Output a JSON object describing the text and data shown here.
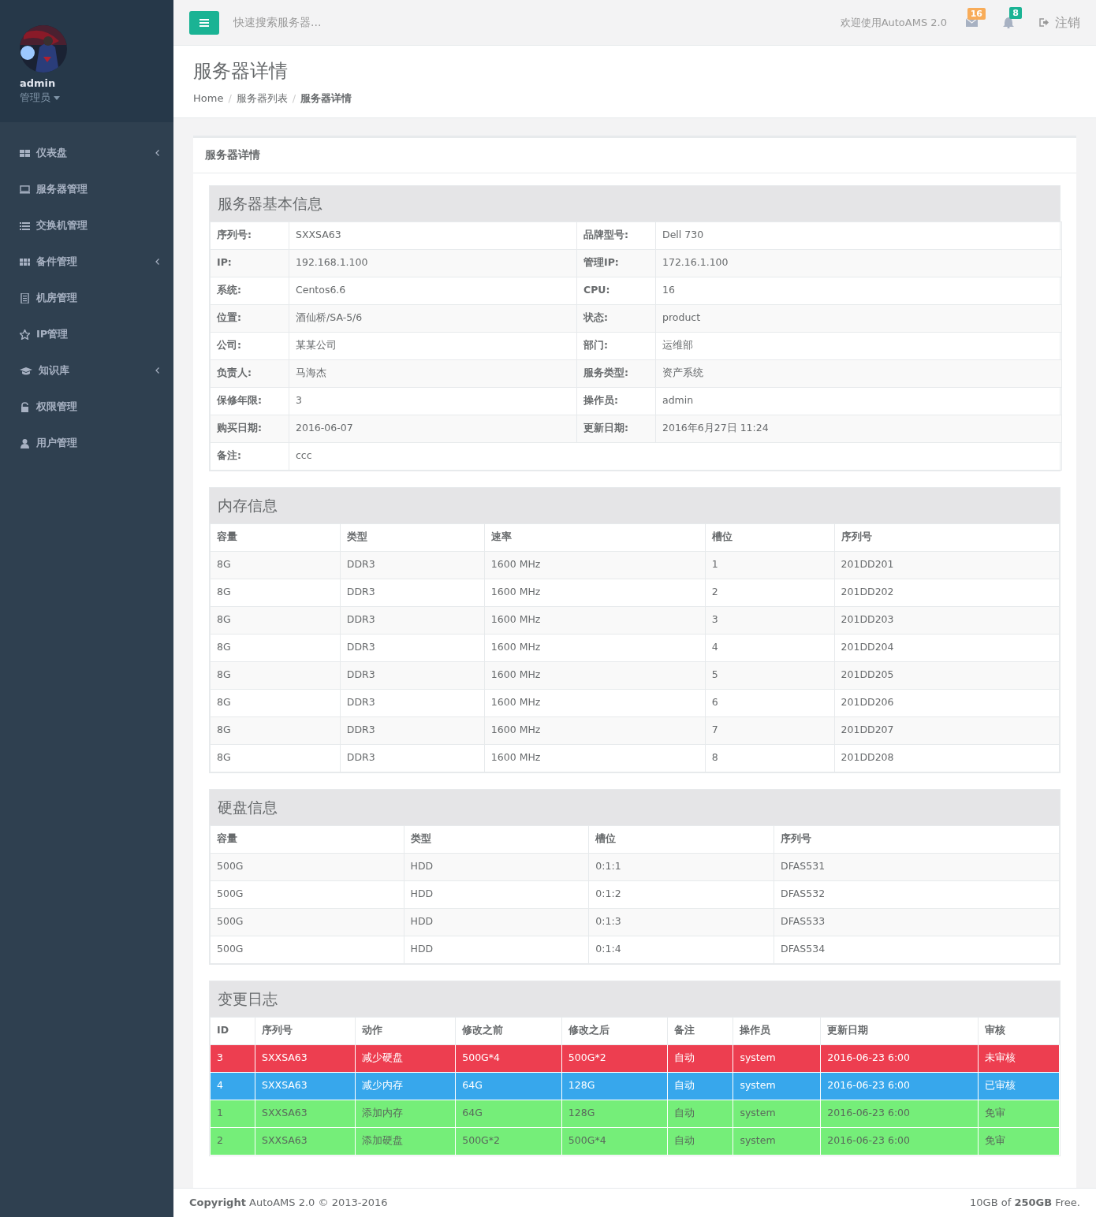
{
  "sidebar": {
    "user": {
      "name": "admin",
      "role": "管理员"
    },
    "items": [
      {
        "label": "仪表盘",
        "expandable": true
      },
      {
        "label": "服务器管理",
        "expandable": false
      },
      {
        "label": "交换机管理",
        "expandable": false
      },
      {
        "label": "备件管理",
        "expandable": true
      },
      {
        "label": "机房管理",
        "expandable": false
      },
      {
        "label": "IP管理",
        "expandable": false
      },
      {
        "label": "知识库",
        "expandable": true
      },
      {
        "label": "权限管理",
        "expandable": false
      },
      {
        "label": "用户管理",
        "expandable": false
      }
    ]
  },
  "topbar": {
    "search": {
      "placeholder": "快速搜索服务器..."
    },
    "welcome": "欢迎使用AutoAMS 2.0",
    "mail_count": "16",
    "alert_count": "8",
    "logout": "注销"
  },
  "page": {
    "title": "服务器详情",
    "breadcrumb": [
      {
        "label": "Home",
        "selected": false
      },
      {
        "separator": "/",
        "label": "服务器列表",
        "selected": false
      },
      {
        "separator": "/",
        "label": "服务器详情",
        "selected": true
      }
    ]
  },
  "panel": {
    "title": "服务器详情",
    "basic": {
      "title": "服务器基本信息",
      "rows": [
        [
          "序列号:",
          "SXXSA63",
          "品牌型号:",
          "Dell 730"
        ],
        [
          "IP:",
          "192.168.1.100",
          "管理IP:",
          "172.16.1.100"
        ],
        [
          "系统:",
          "Centos6.6",
          "CPU:",
          "16"
        ],
        [
          "位置:",
          "酒仙桥/SA-5/6",
          "状态:",
          "product"
        ],
        [
          "公司:",
          "某某公司",
          "部门:",
          "运维部"
        ],
        [
          "负责人:",
          "马海杰",
          "服务类型:",
          "资产系统"
        ],
        [
          "保修年限:",
          "3",
          "操作员:",
          "admin"
        ],
        [
          "购买日期:",
          "2016-06-07",
          "更新日期:",
          "2016年6月27日 11:24"
        ],
        [
          "备注:",
          "ccc"
        ]
      ]
    },
    "memory": {
      "title": "内存信息",
      "columns": [
        "容量",
        "类型",
        "速率",
        "槽位",
        "序列号"
      ],
      "rows": [
        [
          "8G",
          "DDR3",
          "1600 MHz",
          "1",
          "201DD201"
        ],
        [
          "8G",
          "DDR3",
          "1600 MHz",
          "2",
          "201DD202"
        ],
        [
          "8G",
          "DDR3",
          "1600 MHz",
          "3",
          "201DD203"
        ],
        [
          "8G",
          "DDR3",
          "1600 MHz",
          "4",
          "201DD204"
        ],
        [
          "8G",
          "DDR3",
          "1600 MHz",
          "5",
          "201DD205"
        ],
        [
          "8G",
          "DDR3",
          "1600 MHz",
          "6",
          "201DD206"
        ],
        [
          "8G",
          "DDR3",
          "1600 MHz",
          "7",
          "201DD207"
        ],
        [
          "8G",
          "DDR3",
          "1600 MHz",
          "8",
          "201DD208"
        ]
      ]
    },
    "disk": {
      "title": "硬盘信息",
      "columns": [
        "容量",
        "类型",
        "槽位",
        "序列号"
      ],
      "rows": [
        [
          "500G",
          "HDD",
          "0:1:1",
          "DFAS531"
        ],
        [
          "500G",
          "HDD",
          "0:1:2",
          "DFAS532"
        ],
        [
          "500G",
          "HDD",
          "0:1:3",
          "DFAS533"
        ],
        [
          "500G",
          "HDD",
          "0:1:4",
          "DFAS534"
        ]
      ]
    },
    "log": {
      "title": "变更日志",
      "columns": [
        "ID",
        "序列号",
        "动作",
        "修改之前",
        "修改之后",
        "备注",
        "操作员",
        "更新日期",
        "审核"
      ],
      "rows": [
        {
          "color": "#ed3e50",
          "cells": [
            "3",
            "SXXSA63",
            "减少硬盘",
            "500G*4",
            "500G*2",
            "自动",
            "system",
            "2016-06-23 6:00",
            "未审核"
          ]
        },
        {
          "color": "#37a7ec",
          "cells": [
            "4",
            "SXXSA63",
            "减少内存",
            "64G",
            "128G",
            "自动",
            "system",
            "2016-06-23 6:00",
            "已审核"
          ]
        },
        {
          "color": "#75ee79",
          "cells": [
            "1",
            "SXXSA63",
            "添加内存",
            "64G",
            "128G",
            "自动",
            "system",
            "2016-06-23 6:00",
            "免审"
          ]
        },
        {
          "color": "#75ee79",
          "cells": [
            "2",
            "SXXSA63",
            "添加硬盘",
            "500G*2",
            "500G*4",
            "自动",
            "system",
            "2016-06-23 6:00",
            "免审"
          ]
        }
      ]
    }
  },
  "footer": {
    "left": "**Copyright** AutoAMS 2.0 © 2013-2016",
    "right": "10GB of **250GB** Free."
  }
}
